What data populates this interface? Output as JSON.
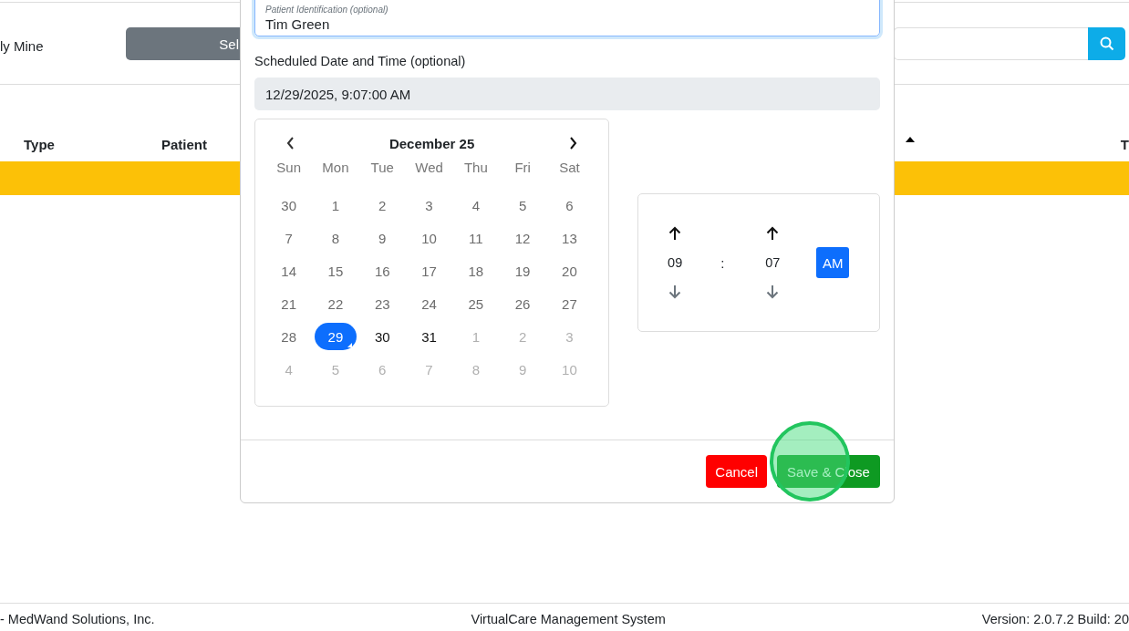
{
  "filter_bar": {
    "scope_label": "ly Mine",
    "select_button": "Sel"
  },
  "table": {
    "columns": [
      {
        "label": "Type"
      },
      {
        "label": "Patient"
      },
      {
        "label": "T"
      }
    ],
    "sort": {
      "column_sorted": true
    },
    "rows": [
      {
        "kind": "highlighted"
      }
    ]
  },
  "dialog": {
    "patient_field": {
      "label": "Patient Identification (optional)",
      "value": "Tim Green",
      "focused": true
    },
    "date_label": "Scheduled Date and Time (optional)",
    "date_value": "12/29/2025, 9:07:00 AM",
    "calendar": {
      "title": "December 25",
      "weekdays": [
        "Sun",
        "Mon",
        "Tue",
        "Wed",
        "Thu",
        "Fri",
        "Sat"
      ],
      "days": [
        {
          "label": "30",
          "kind": "past",
          "selected": false
        },
        {
          "label": "1",
          "kind": "past",
          "selected": false
        },
        {
          "label": "2",
          "kind": "past",
          "selected": false
        },
        {
          "label": "3",
          "kind": "past",
          "selected": false
        },
        {
          "label": "4",
          "kind": "past",
          "selected": false
        },
        {
          "label": "5",
          "kind": "past",
          "selected": false
        },
        {
          "label": "6",
          "kind": "past",
          "selected": false
        },
        {
          "label": "7",
          "kind": "past",
          "selected": false
        },
        {
          "label": "8",
          "kind": "past",
          "selected": false
        },
        {
          "label": "9",
          "kind": "past",
          "selected": false
        },
        {
          "label": "10",
          "kind": "past",
          "selected": false
        },
        {
          "label": "11",
          "kind": "past",
          "selected": false
        },
        {
          "label": "12",
          "kind": "past",
          "selected": false
        },
        {
          "label": "13",
          "kind": "past",
          "selected": false
        },
        {
          "label": "14",
          "kind": "past",
          "selected": false
        },
        {
          "label": "15",
          "kind": "past",
          "selected": false
        },
        {
          "label": "16",
          "kind": "past",
          "selected": false
        },
        {
          "label": "17",
          "kind": "past",
          "selected": false
        },
        {
          "label": "18",
          "kind": "past",
          "selected": false
        },
        {
          "label": "19",
          "kind": "past",
          "selected": false
        },
        {
          "label": "20",
          "kind": "past",
          "selected": false
        },
        {
          "label": "21",
          "kind": "past",
          "selected": false
        },
        {
          "label": "22",
          "kind": "past",
          "selected": false
        },
        {
          "label": "23",
          "kind": "past",
          "selected": false
        },
        {
          "label": "24",
          "kind": "past",
          "selected": false
        },
        {
          "label": "25",
          "kind": "past",
          "selected": false
        },
        {
          "label": "26",
          "kind": "past",
          "selected": false
        },
        {
          "label": "27",
          "kind": "past",
          "selected": false
        },
        {
          "label": "28",
          "kind": "past",
          "selected": false
        },
        {
          "label": "29",
          "kind": "current",
          "selected": true
        },
        {
          "label": "30",
          "kind": "current",
          "selected": false
        },
        {
          "label": "31",
          "kind": "current",
          "selected": false
        },
        {
          "label": "1",
          "kind": "outside",
          "selected": false
        },
        {
          "label": "2",
          "kind": "outside",
          "selected": false
        },
        {
          "label": "3",
          "kind": "outside",
          "selected": false
        },
        {
          "label": "4",
          "kind": "outside",
          "selected": false
        },
        {
          "label": "5",
          "kind": "outside",
          "selected": false
        },
        {
          "label": "6",
          "kind": "outside",
          "selected": false
        },
        {
          "label": "7",
          "kind": "outside",
          "selected": false
        },
        {
          "label": "8",
          "kind": "outside",
          "selected": false
        },
        {
          "label": "9",
          "kind": "outside",
          "selected": false
        },
        {
          "label": "10",
          "kind": "outside",
          "selected": false
        }
      ]
    },
    "time": {
      "hours": "09",
      "separator": ":",
      "minutes": "07",
      "period": "AM"
    },
    "buttons": [
      {
        "label": "Cancel",
        "kind": "danger"
      },
      {
        "label": "Save & Close",
        "kind": "success",
        "clicked": true
      }
    ]
  },
  "footer": {
    "left": "- MedWand Solutions, Inc.",
    "center": "VirtualCare Management System",
    "right": "Version: 2.0.7.2 Build: 20"
  }
}
